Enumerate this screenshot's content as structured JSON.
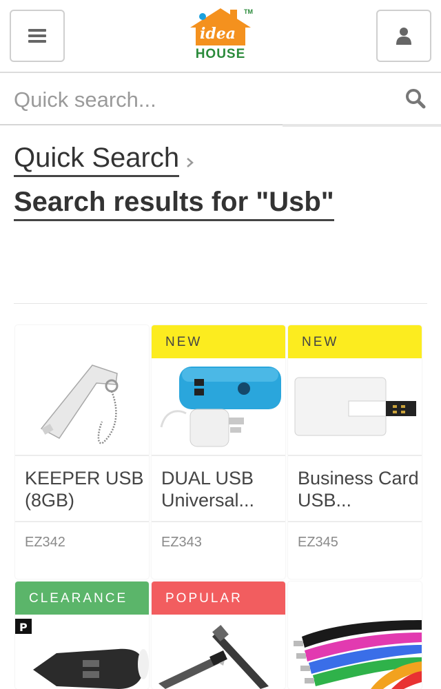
{
  "header": {
    "logo_word": "idea",
    "logo_text": "HOUSE",
    "logo_tm": "TM",
    "colors": {
      "logo_orange": "#f4911e",
      "logo_green": "#2a8a3a",
      "logo_dot": "#1aa0dd"
    }
  },
  "search": {
    "placeholder": "Quick search..."
  },
  "breadcrumb": {
    "link": "Quick Search",
    "title": "Search results for \"Usb\""
  },
  "products": [
    {
      "badge": "",
      "name": "KEEPER USB (8GB)",
      "code": "EZ342"
    },
    {
      "badge": "NEW",
      "name": "DUAL USB Universal...",
      "code": "EZ343"
    },
    {
      "badge": "NEW",
      "name": "Business Card USB...",
      "code": "EZ345"
    },
    {
      "badge": "CLEARANCE",
      "name": "",
      "code": ""
    },
    {
      "badge": "POPULAR",
      "name": "",
      "code": ""
    },
    {
      "badge": "",
      "name": "",
      "code": ""
    }
  ],
  "colors": {
    "badge_new": "#fcec1f",
    "badge_clearance": "#5bb56a",
    "badge_popular": "#f25d5f"
  }
}
